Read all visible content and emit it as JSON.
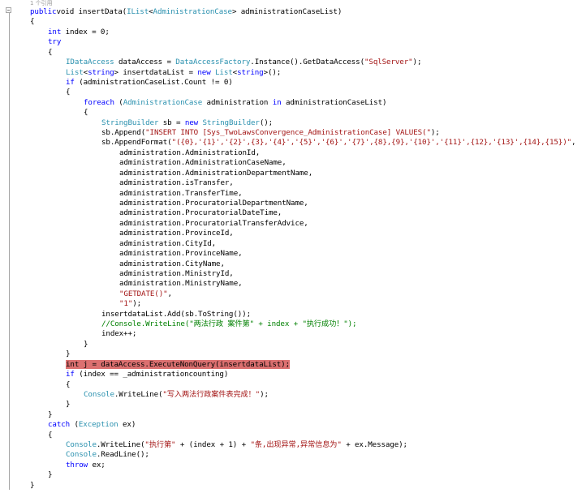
{
  "codelens": "1 个引用",
  "colors": {
    "keyword": "#0000ff",
    "type": "#2b91af",
    "string": "#a31515",
    "comment": "#008000",
    "highlight": "#dc7070"
  },
  "lines": [
    {
      "indent": 0,
      "tokens": [
        [
          "kw",
          "public"
        ],
        [
          "",
          "void insertData("
        ],
        [
          "ty",
          "IList"
        ],
        [
          "",
          "<"
        ],
        [
          "ty",
          "AdministrationCase"
        ],
        [
          "",
          "> administrationCaseList)"
        ]
      ]
    },
    {
      "indent": 0,
      "tokens": [
        [
          "",
          "{"
        ]
      ]
    },
    {
      "indent": 1,
      "tokens": [
        [
          "kw",
          "int"
        ],
        [
          "",
          " index = 0;"
        ]
      ]
    },
    {
      "indent": 1,
      "tokens": [
        [
          "kw",
          "try"
        ]
      ]
    },
    {
      "indent": 1,
      "tokens": [
        [
          "",
          "{"
        ]
      ]
    },
    {
      "indent": 2,
      "tokens": [
        [
          "ty",
          "IDataAccess"
        ],
        [
          "",
          " dataAccess = "
        ],
        [
          "ty",
          "DataAccessFactory"
        ],
        [
          "",
          ".Instance().GetDataAccess("
        ],
        [
          "st",
          "\"SqlServer\""
        ],
        [
          "",
          ");"
        ]
      ]
    },
    {
      "indent": 2,
      "tokens": [
        [
          "ty",
          "List"
        ],
        [
          "",
          "<"
        ],
        [
          "kw",
          "string"
        ],
        [
          "",
          "> insertdataList = "
        ],
        [
          "kw",
          "new"
        ],
        [
          "",
          ""
        ],
        [
          "ty",
          " List"
        ],
        [
          "",
          "<"
        ],
        [
          "kw",
          "string"
        ],
        [
          "",
          ">();"
        ]
      ]
    },
    {
      "indent": 2,
      "tokens": [
        [
          "kw",
          "if"
        ],
        [
          "",
          " (administrationCaseList.Count != 0)"
        ]
      ]
    },
    {
      "indent": 2,
      "tokens": [
        [
          "",
          "{"
        ]
      ]
    },
    {
      "indent": 3,
      "tokens": [
        [
          "kw",
          "foreach"
        ],
        [
          "",
          " ("
        ],
        [
          "ty",
          "AdministrationCase"
        ],
        [
          "",
          " administration "
        ],
        [
          "kw",
          "in"
        ],
        [
          "",
          " administrationCaseList)"
        ]
      ]
    },
    {
      "indent": 3,
      "tokens": [
        [
          "",
          "{"
        ]
      ]
    },
    {
      "indent": 4,
      "tokens": [
        [
          "ty",
          "StringBuilder"
        ],
        [
          "",
          " sb = "
        ],
        [
          "kw",
          "new"
        ],
        [
          "ty",
          " StringBuilder"
        ],
        [
          "",
          "();"
        ]
      ]
    },
    {
      "indent": 4,
      "tokens": [
        [
          "",
          "sb.Append("
        ],
        [
          "st",
          "\"INSERT INTO [Sys_TwoLawsConvergence_AdministrationCase] VALUES(\""
        ],
        [
          "",
          ");"
        ]
      ]
    },
    {
      "indent": 4,
      "tokens": [
        [
          "",
          "sb.AppendFormat("
        ],
        [
          "st",
          "\"({0},'{1}','{2}',{3},'{4}','{5}','{6}','{7}',{8},{9},'{10}','{11}',{12},'{13}',{14},{15})\""
        ],
        [
          "",
          ","
        ]
      ]
    },
    {
      "indent": 5,
      "tokens": [
        [
          "",
          "administration.AdministrationId,"
        ]
      ]
    },
    {
      "indent": 5,
      "tokens": [
        [
          "",
          "administration.AdministrationCaseName,"
        ]
      ]
    },
    {
      "indent": 5,
      "tokens": [
        [
          "",
          "administration.AdministrationDepartmentName,"
        ]
      ]
    },
    {
      "indent": 5,
      "tokens": [
        [
          "",
          "administration.isTransfer,"
        ]
      ]
    },
    {
      "indent": 5,
      "tokens": [
        [
          "",
          "administration.TransferTime,"
        ]
      ]
    },
    {
      "indent": 5,
      "tokens": [
        [
          "",
          "administration.ProcuratorialDepartmentName,"
        ]
      ]
    },
    {
      "indent": 5,
      "tokens": [
        [
          "",
          "administration.ProcuratorialDateTime,"
        ]
      ]
    },
    {
      "indent": 5,
      "tokens": [
        [
          "",
          "administration.ProcuratorialTransferAdvice,"
        ]
      ]
    },
    {
      "indent": 5,
      "tokens": [
        [
          "",
          "administration.ProvinceId,"
        ]
      ]
    },
    {
      "indent": 5,
      "tokens": [
        [
          "",
          "administration.CityId,"
        ]
      ]
    },
    {
      "indent": 5,
      "tokens": [
        [
          "",
          "administration.ProvinceName,"
        ]
      ]
    },
    {
      "indent": 5,
      "tokens": [
        [
          "",
          "administration.CityName,"
        ]
      ]
    },
    {
      "indent": 5,
      "tokens": [
        [
          "",
          "administration.MinistryId,"
        ]
      ]
    },
    {
      "indent": 5,
      "tokens": [
        [
          "",
          "administration.MinistryName,"
        ]
      ]
    },
    {
      "indent": 5,
      "tokens": [
        [
          "st",
          "\"GETDATE()\""
        ],
        [
          "",
          ","
        ]
      ]
    },
    {
      "indent": 5,
      "tokens": [
        [
          "st",
          "\"1\""
        ],
        [
          "",
          ");"
        ]
      ]
    },
    {
      "indent": 4,
      "tokens": [
        [
          "",
          "insertdataList.Add(sb.ToString());"
        ]
      ]
    },
    {
      "indent": 4,
      "tokens": [
        [
          "cm",
          "//Console.WriteLine(\"两法行政 案件第\" + index + \"执行成功！\");"
        ]
      ]
    },
    {
      "indent": 4,
      "tokens": [
        [
          "",
          "index++;"
        ]
      ]
    },
    {
      "indent": 3,
      "tokens": [
        [
          "",
          "}"
        ]
      ]
    },
    {
      "indent": 2,
      "tokens": [
        [
          "",
          "}"
        ]
      ]
    },
    {
      "indent": 2,
      "highlight": true,
      "tokens": [
        [
          "hl",
          "int j = dataAccess.ExecuteNonQuery(insertdataList);"
        ]
      ]
    },
    {
      "indent": 2,
      "tokens": [
        [
          "kw",
          "if"
        ],
        [
          "",
          " (index == _administrationcounting)"
        ]
      ]
    },
    {
      "indent": 2,
      "tokens": [
        [
          "",
          "{"
        ]
      ]
    },
    {
      "indent": 3,
      "tokens": [
        [
          "ty",
          "Console"
        ],
        [
          "",
          ".WriteLine("
        ],
        [
          "st",
          "\"写入两法行政案件表完成！\""
        ],
        [
          "",
          ");"
        ]
      ]
    },
    {
      "indent": 2,
      "tokens": [
        [
          "",
          "}"
        ]
      ]
    },
    {
      "indent": 1,
      "tokens": [
        [
          "",
          "}"
        ]
      ]
    },
    {
      "indent": 1,
      "tokens": [
        [
          "kw",
          "catch"
        ],
        [
          "",
          " ("
        ],
        [
          "ty",
          "Exception"
        ],
        [
          "",
          " ex)"
        ]
      ]
    },
    {
      "indent": 1,
      "tokens": [
        [
          "",
          "{"
        ]
      ]
    },
    {
      "indent": 2,
      "tokens": [
        [
          "ty",
          "Console"
        ],
        [
          "",
          ".WriteLine("
        ],
        [
          "st",
          "\"执行第\""
        ],
        [
          "",
          " + (index + 1) + "
        ],
        [
          "st",
          "\"条,出现异常,异常信息为\""
        ],
        [
          "",
          " + ex.Message);"
        ]
      ]
    },
    {
      "indent": 2,
      "tokens": [
        [
          "ty",
          "Console"
        ],
        [
          "",
          ".ReadLine();"
        ]
      ]
    },
    {
      "indent": 2,
      "tokens": [
        [
          "kw",
          "throw"
        ],
        [
          "",
          " ex;"
        ]
      ]
    },
    {
      "indent": 1,
      "tokens": [
        [
          "",
          "}"
        ]
      ]
    },
    {
      "indent": 0,
      "tokens": [
        [
          "",
          "}"
        ]
      ]
    }
  ]
}
